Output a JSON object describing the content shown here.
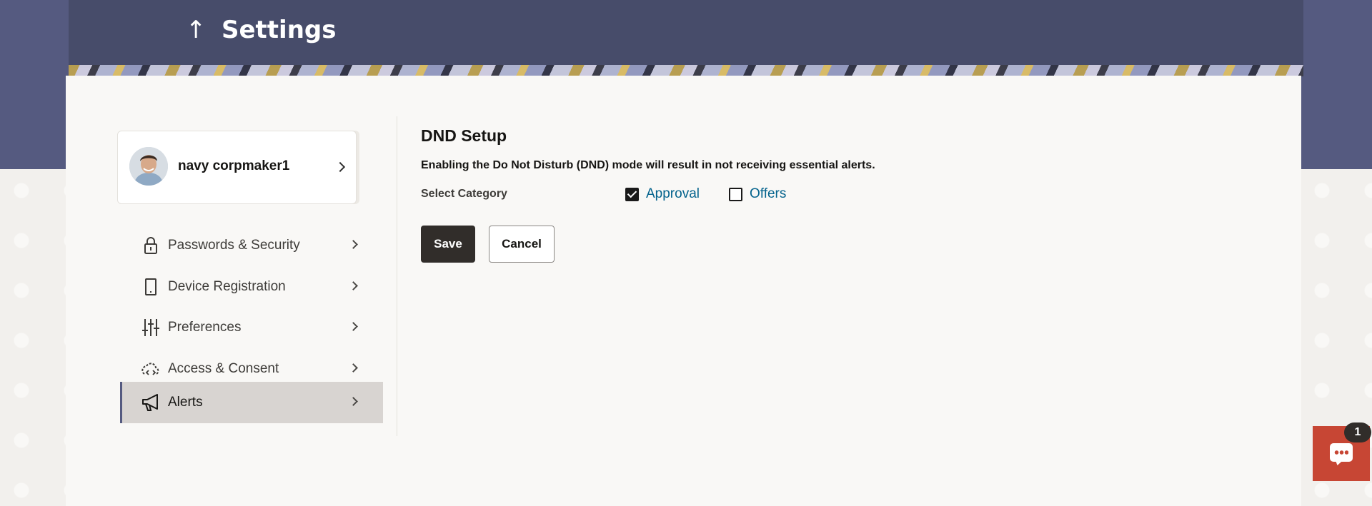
{
  "header": {
    "title": "Settings",
    "back_icon": "arrow-up-icon"
  },
  "profile": {
    "name": "navy corpmaker1"
  },
  "sidebar": {
    "items": [
      {
        "label": "Passwords & Security",
        "icon": "lock-icon",
        "active": false
      },
      {
        "label": "Device Registration",
        "icon": "device-icon",
        "active": false
      },
      {
        "label": "Preferences",
        "icon": "sliders-icon",
        "active": false
      },
      {
        "label": "Access & Consent",
        "icon": "cloud-code-icon",
        "active": false
      },
      {
        "label": "Alerts",
        "icon": "megaphone-icon",
        "active": true
      }
    ]
  },
  "main": {
    "title": "DND Setup",
    "description": "Enabling the Do Not Disturb (DND) mode will result in not receiving essential alerts.",
    "category_label": "Select Category",
    "categories": [
      {
        "label": "Approval",
        "checked": true
      },
      {
        "label": "Offers",
        "checked": false
      }
    ],
    "save_label": "Save",
    "cancel_label": "Cancel"
  },
  "chat": {
    "badge_count": "1",
    "icon": "chat-icon"
  },
  "colors": {
    "header_bg": "#474c6a",
    "primary_button": "#312d2a",
    "link": "#04638d",
    "chat_bg": "#c74634"
  }
}
